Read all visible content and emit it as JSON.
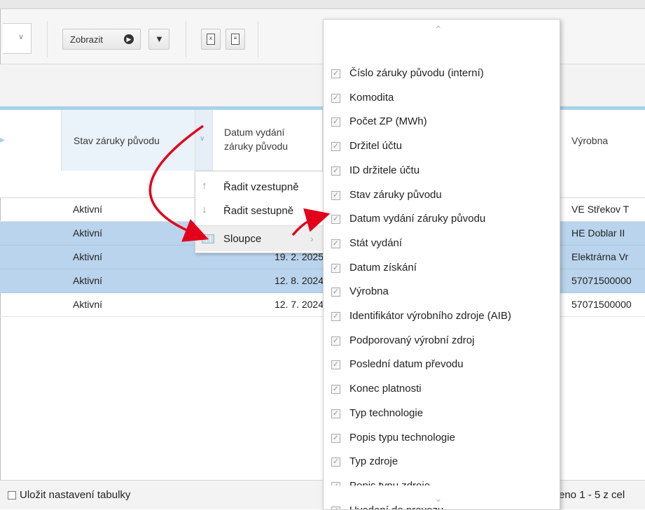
{
  "toolbar": {
    "zobrazit_label": "Zobrazit"
  },
  "header": {
    "col_stav": "Stav záruky původu",
    "col_datum_line1": "Datum vydání",
    "col_datum_line2": "záruky původu",
    "col_vyrobna": "Výrobna"
  },
  "rows": [
    {
      "stav": "Aktivní",
      "datum": "",
      "vyrobna": "VE Střekov T"
    },
    {
      "stav": "Aktivní",
      "datum": "",
      "vyrobna": "HE Doblar II"
    },
    {
      "stav": "Aktivní",
      "datum": "19. 2. 2025",
      "vyrobna": "Elektrárna Vr"
    },
    {
      "stav": "Aktivní",
      "datum": "12. 8. 2024",
      "vyrobna": "57071500000"
    },
    {
      "stav": "Aktivní",
      "datum": "12. 7. 2024",
      "vyrobna": "57071500000"
    }
  ],
  "context_menu": {
    "sort_asc": "Řadit vzestupně",
    "sort_desc": "Řadit sestupně",
    "columns": "Sloupce"
  },
  "columns_menu": {
    "items": [
      "Číslo záruky původu (interní)",
      "Komodita",
      "Počet ZP (MWh)",
      "Držitel účtu",
      "ID držitele účtu",
      "Stav záruky původu",
      "Datum vydání záruky původu",
      "Stát vydání",
      "Datum získání",
      "Výrobna",
      "Identifikátor výrobního zdroje (AIB)",
      "Podporovaný výrobní zdroj",
      "Poslední datum převodu",
      "Konec platnosti",
      "Typ technologie",
      "Popis typu technologie",
      "Typ zdroje",
      "Popis typu zdroje",
      "Uvedení do provozu"
    ]
  },
  "footer": {
    "save_table_label": "Uložit nastavení tabulky",
    "pagination_text": "eno 1 - 5 z cel"
  },
  "colors": {
    "header_accent": "#a7d2e8",
    "row_highlight": "#b9d4ec",
    "annotation_arrow": "#e2001a"
  }
}
